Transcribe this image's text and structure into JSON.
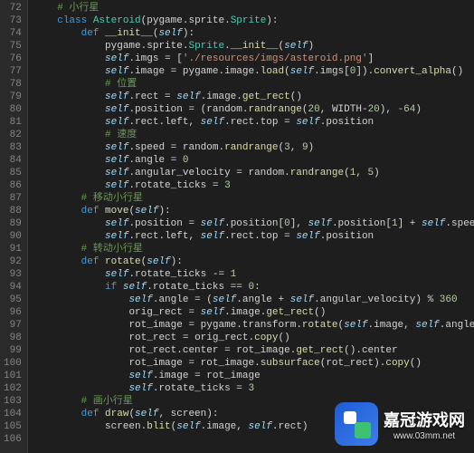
{
  "gutter": {
    "start": 72,
    "end": 106
  },
  "lines": [
    [
      [
        "cmt",
        "    # 小行星"
      ]
    ],
    [
      [
        "pn",
        "    "
      ],
      [
        "kw",
        "class "
      ],
      [
        "cls",
        "Asteroid"
      ],
      [
        "pn",
        "("
      ],
      [
        "id",
        "pygame"
      ],
      [
        "op",
        "."
      ],
      [
        "id",
        "sprite"
      ],
      [
        "op",
        "."
      ],
      [
        "cls",
        "Sprite"
      ],
      [
        "pn",
        "):"
      ]
    ],
    [
      [
        "pn",
        "        "
      ],
      [
        "kw",
        "def "
      ],
      [
        "fn",
        "__init__"
      ],
      [
        "pn",
        "("
      ],
      [
        "self",
        "self"
      ],
      [
        "pn",
        "):"
      ]
    ],
    [
      [
        "pn",
        "            "
      ],
      [
        "id",
        "pygame"
      ],
      [
        "op",
        "."
      ],
      [
        "id",
        "sprite"
      ],
      [
        "op",
        "."
      ],
      [
        "cls",
        "Sprite"
      ],
      [
        "op",
        "."
      ],
      [
        "fn",
        "__init__"
      ],
      [
        "pn",
        "("
      ],
      [
        "self",
        "self"
      ],
      [
        "pn",
        ")"
      ]
    ],
    [
      [
        "pn",
        "            "
      ],
      [
        "self",
        "self"
      ],
      [
        "op",
        "."
      ],
      [
        "prop",
        "imgs"
      ],
      [
        "op",
        " = "
      ],
      [
        "pn",
        "["
      ],
      [
        "str",
        "'./resources/imgs/asteroid.png'"
      ],
      [
        "pn",
        "]"
      ]
    ],
    [
      [
        "pn",
        "            "
      ],
      [
        "self",
        "self"
      ],
      [
        "op",
        "."
      ],
      [
        "prop",
        "image"
      ],
      [
        "op",
        " = "
      ],
      [
        "id",
        "pygame"
      ],
      [
        "op",
        "."
      ],
      [
        "id",
        "image"
      ],
      [
        "op",
        "."
      ],
      [
        "fn",
        "load"
      ],
      [
        "pn",
        "("
      ],
      [
        "self",
        "self"
      ],
      [
        "op",
        "."
      ],
      [
        "prop",
        "imgs"
      ],
      [
        "pn",
        "["
      ],
      [
        "num",
        "0"
      ],
      [
        "pn",
        "])."
      ],
      [
        "fn",
        "convert_alpha"
      ],
      [
        "pn",
        "()"
      ]
    ],
    [
      [
        "pn",
        "            "
      ],
      [
        "cmt",
        "# 位置"
      ]
    ],
    [
      [
        "pn",
        "            "
      ],
      [
        "self",
        "self"
      ],
      [
        "op",
        "."
      ],
      [
        "prop",
        "rect"
      ],
      [
        "op",
        " = "
      ],
      [
        "self",
        "self"
      ],
      [
        "op",
        "."
      ],
      [
        "prop",
        "image"
      ],
      [
        "op",
        "."
      ],
      [
        "fn",
        "get_rect"
      ],
      [
        "pn",
        "()"
      ]
    ],
    [
      [
        "pn",
        "            "
      ],
      [
        "self",
        "self"
      ],
      [
        "op",
        "."
      ],
      [
        "prop",
        "position"
      ],
      [
        "op",
        " = "
      ],
      [
        "pn",
        "("
      ],
      [
        "id",
        "random"
      ],
      [
        "op",
        "."
      ],
      [
        "fn",
        "randrange"
      ],
      [
        "pn",
        "("
      ],
      [
        "num",
        "20"
      ],
      [
        "pn",
        ", "
      ],
      [
        "id",
        "WIDTH"
      ],
      [
        "op",
        "-"
      ],
      [
        "num",
        "20"
      ],
      [
        "pn",
        "), "
      ],
      [
        "num",
        "-64"
      ],
      [
        "pn",
        ")"
      ]
    ],
    [
      [
        "pn",
        "            "
      ],
      [
        "self",
        "self"
      ],
      [
        "op",
        "."
      ],
      [
        "prop",
        "rect"
      ],
      [
        "op",
        "."
      ],
      [
        "prop",
        "left"
      ],
      [
        "pn",
        ", "
      ],
      [
        "self",
        "self"
      ],
      [
        "op",
        "."
      ],
      [
        "prop",
        "rect"
      ],
      [
        "op",
        "."
      ],
      [
        "prop",
        "top"
      ],
      [
        "op",
        " = "
      ],
      [
        "self",
        "self"
      ],
      [
        "op",
        "."
      ],
      [
        "prop",
        "position"
      ]
    ],
    [
      [
        "pn",
        "            "
      ],
      [
        "cmt",
        "# 速度"
      ]
    ],
    [
      [
        "pn",
        "            "
      ],
      [
        "self",
        "self"
      ],
      [
        "op",
        "."
      ],
      [
        "prop",
        "speed"
      ],
      [
        "op",
        " = "
      ],
      [
        "id",
        "random"
      ],
      [
        "op",
        "."
      ],
      [
        "fn",
        "randrange"
      ],
      [
        "pn",
        "("
      ],
      [
        "num",
        "3"
      ],
      [
        "pn",
        ", "
      ],
      [
        "num",
        "9"
      ],
      [
        "pn",
        ")"
      ]
    ],
    [
      [
        "pn",
        "            "
      ],
      [
        "self",
        "self"
      ],
      [
        "op",
        "."
      ],
      [
        "prop",
        "angle"
      ],
      [
        "op",
        " = "
      ],
      [
        "num",
        "0"
      ]
    ],
    [
      [
        "pn",
        "            "
      ],
      [
        "self",
        "self"
      ],
      [
        "op",
        "."
      ],
      [
        "prop",
        "angular_velocity"
      ],
      [
        "op",
        " = "
      ],
      [
        "id",
        "random"
      ],
      [
        "op",
        "."
      ],
      [
        "fn",
        "randrange"
      ],
      [
        "pn",
        "("
      ],
      [
        "num",
        "1"
      ],
      [
        "pn",
        ", "
      ],
      [
        "num",
        "5"
      ],
      [
        "pn",
        ")"
      ]
    ],
    [
      [
        "pn",
        "            "
      ],
      [
        "self",
        "self"
      ],
      [
        "op",
        "."
      ],
      [
        "prop",
        "rotate_ticks"
      ],
      [
        "op",
        " = "
      ],
      [
        "num",
        "3"
      ]
    ],
    [
      [
        "pn",
        "        "
      ],
      [
        "cmt",
        "# 移动小行星"
      ]
    ],
    [
      [
        "pn",
        "        "
      ],
      [
        "kw",
        "def "
      ],
      [
        "fn",
        "move"
      ],
      [
        "pn",
        "("
      ],
      [
        "self",
        "self"
      ],
      [
        "pn",
        "):"
      ]
    ],
    [
      [
        "pn",
        "            "
      ],
      [
        "self",
        "self"
      ],
      [
        "op",
        "."
      ],
      [
        "prop",
        "position"
      ],
      [
        "op",
        " = "
      ],
      [
        "self",
        "self"
      ],
      [
        "op",
        "."
      ],
      [
        "prop",
        "position"
      ],
      [
        "pn",
        "["
      ],
      [
        "num",
        "0"
      ],
      [
        "pn",
        "], "
      ],
      [
        "self",
        "self"
      ],
      [
        "op",
        "."
      ],
      [
        "prop",
        "position"
      ],
      [
        "pn",
        "["
      ],
      [
        "num",
        "1"
      ],
      [
        "pn",
        "] "
      ],
      [
        "op",
        "+ "
      ],
      [
        "self",
        "self"
      ],
      [
        "op",
        "."
      ],
      [
        "prop",
        "speed"
      ]
    ],
    [
      [
        "pn",
        "            "
      ],
      [
        "self",
        "self"
      ],
      [
        "op",
        "."
      ],
      [
        "prop",
        "rect"
      ],
      [
        "op",
        "."
      ],
      [
        "prop",
        "left"
      ],
      [
        "pn",
        ", "
      ],
      [
        "self",
        "self"
      ],
      [
        "op",
        "."
      ],
      [
        "prop",
        "rect"
      ],
      [
        "op",
        "."
      ],
      [
        "prop",
        "top"
      ],
      [
        "op",
        " = "
      ],
      [
        "self",
        "self"
      ],
      [
        "op",
        "."
      ],
      [
        "prop",
        "position"
      ]
    ],
    [
      [
        "pn",
        "        "
      ],
      [
        "cmt",
        "# 转动小行星"
      ]
    ],
    [
      [
        "pn",
        "        "
      ],
      [
        "kw",
        "def "
      ],
      [
        "fn",
        "rotate"
      ],
      [
        "pn",
        "("
      ],
      [
        "self",
        "self"
      ],
      [
        "pn",
        "):"
      ]
    ],
    [
      [
        "pn",
        "            "
      ],
      [
        "self",
        "self"
      ],
      [
        "op",
        "."
      ],
      [
        "prop",
        "rotate_ticks"
      ],
      [
        "op",
        " -= "
      ],
      [
        "num",
        "1"
      ]
    ],
    [
      [
        "pn",
        "            "
      ],
      [
        "kw",
        "if "
      ],
      [
        "self",
        "self"
      ],
      [
        "op",
        "."
      ],
      [
        "prop",
        "rotate_ticks"
      ],
      [
        "op",
        " == "
      ],
      [
        "num",
        "0"
      ],
      [
        "pn",
        ":"
      ]
    ],
    [
      [
        "pn",
        "                "
      ],
      [
        "self",
        "self"
      ],
      [
        "op",
        "."
      ],
      [
        "prop",
        "angle"
      ],
      [
        "op",
        " = "
      ],
      [
        "pn",
        "("
      ],
      [
        "self",
        "self"
      ],
      [
        "op",
        "."
      ],
      [
        "prop",
        "angle"
      ],
      [
        "op",
        " + "
      ],
      [
        "self",
        "self"
      ],
      [
        "op",
        "."
      ],
      [
        "prop",
        "angular_velocity"
      ],
      [
        "pn",
        ") "
      ],
      [
        "op",
        "% "
      ],
      [
        "num",
        "360"
      ]
    ],
    [
      [
        "pn",
        "                "
      ],
      [
        "id",
        "orig_rect"
      ],
      [
        "op",
        " = "
      ],
      [
        "self",
        "self"
      ],
      [
        "op",
        "."
      ],
      [
        "prop",
        "image"
      ],
      [
        "op",
        "."
      ],
      [
        "fn",
        "get_rect"
      ],
      [
        "pn",
        "()"
      ]
    ],
    [
      [
        "pn",
        "                "
      ],
      [
        "id",
        "rot_image"
      ],
      [
        "op",
        " = "
      ],
      [
        "id",
        "pygame"
      ],
      [
        "op",
        "."
      ],
      [
        "id",
        "transform"
      ],
      [
        "op",
        "."
      ],
      [
        "fn",
        "rotate"
      ],
      [
        "pn",
        "("
      ],
      [
        "self",
        "self"
      ],
      [
        "op",
        "."
      ],
      [
        "prop",
        "image"
      ],
      [
        "pn",
        ", "
      ],
      [
        "self",
        "self"
      ],
      [
        "op",
        "."
      ],
      [
        "prop",
        "angle"
      ],
      [
        "pn",
        ")"
      ]
    ],
    [
      [
        "pn",
        "                "
      ],
      [
        "id",
        "rot_rect"
      ],
      [
        "op",
        " = "
      ],
      [
        "id",
        "orig_rect"
      ],
      [
        "op",
        "."
      ],
      [
        "fn",
        "copy"
      ],
      [
        "pn",
        "()"
      ]
    ],
    [
      [
        "pn",
        "                "
      ],
      [
        "id",
        "rot_rect"
      ],
      [
        "op",
        "."
      ],
      [
        "prop",
        "center"
      ],
      [
        "op",
        " = "
      ],
      [
        "id",
        "rot_image"
      ],
      [
        "op",
        "."
      ],
      [
        "fn",
        "get_rect"
      ],
      [
        "pn",
        "()."
      ],
      [
        "prop",
        "center"
      ]
    ],
    [
      [
        "pn",
        "                "
      ],
      [
        "id",
        "rot_image"
      ],
      [
        "op",
        " = "
      ],
      [
        "id",
        "rot_image"
      ],
      [
        "op",
        "."
      ],
      [
        "fn",
        "subsurface"
      ],
      [
        "pn",
        "("
      ],
      [
        "id",
        "rot_rect"
      ],
      [
        "pn",
        ")."
      ],
      [
        "fn",
        "copy"
      ],
      [
        "pn",
        "()"
      ]
    ],
    [
      [
        "pn",
        "                "
      ],
      [
        "self",
        "self"
      ],
      [
        "op",
        "."
      ],
      [
        "prop",
        "image"
      ],
      [
        "op",
        " = "
      ],
      [
        "id",
        "rot_image"
      ]
    ],
    [
      [
        "pn",
        "                "
      ],
      [
        "self",
        "self"
      ],
      [
        "op",
        "."
      ],
      [
        "prop",
        "rotate_ticks"
      ],
      [
        "op",
        " = "
      ],
      [
        "num",
        "3"
      ]
    ],
    [
      [
        "pn",
        "        "
      ],
      [
        "cmt",
        "# 画小行星"
      ]
    ],
    [
      [
        "pn",
        "        "
      ],
      [
        "kw",
        "def "
      ],
      [
        "fn",
        "draw"
      ],
      [
        "pn",
        "("
      ],
      [
        "self",
        "self"
      ],
      [
        "pn",
        ", "
      ],
      [
        "id",
        "screen"
      ],
      [
        "pn",
        "):"
      ]
    ],
    [
      [
        "pn",
        "            "
      ],
      [
        "id",
        "screen"
      ],
      [
        "op",
        "."
      ],
      [
        "fn",
        "blit"
      ],
      [
        "pn",
        "("
      ],
      [
        "self",
        "self"
      ],
      [
        "op",
        "."
      ],
      [
        "prop",
        "image"
      ],
      [
        "pn",
        ", "
      ],
      [
        "self",
        "self"
      ],
      [
        "op",
        "."
      ],
      [
        "prop",
        "rect"
      ],
      [
        "pn",
        ")"
      ]
    ]
  ],
  "watermark": {
    "title": "嘉冠游戏网",
    "url": "www.03mm.net"
  }
}
